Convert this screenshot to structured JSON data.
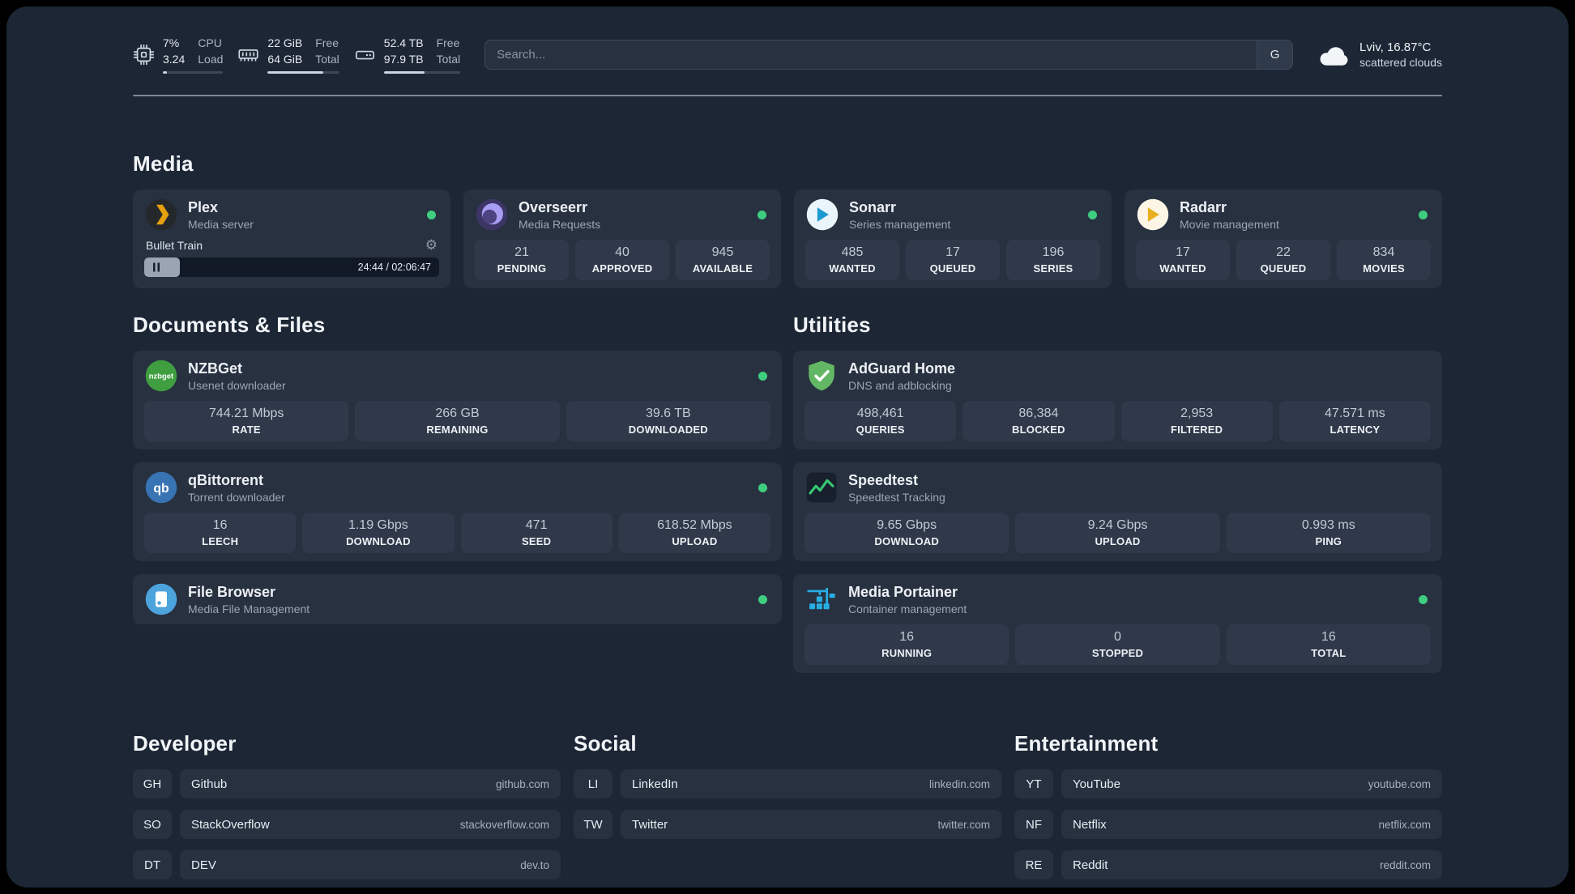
{
  "topbar": {
    "resources": [
      {
        "icon": "cpu-icon",
        "values": [
          "7%",
          "3.24"
        ],
        "labels": [
          "CPU",
          "Load"
        ],
        "percent": 7
      },
      {
        "icon": "memory-icon",
        "values": [
          "22 GiB",
          "64 GiB"
        ],
        "labels": [
          "Free",
          "Total"
        ],
        "percent": 78
      },
      {
        "icon": "disk-icon",
        "values": [
          "52.4 TB",
          "97.9 TB"
        ],
        "labels": [
          "Free",
          "Total"
        ],
        "percent": 53
      }
    ],
    "search": {
      "placeholder": "Search...",
      "button_label": "G"
    },
    "weather": {
      "location": "Lviv, 16.87°C",
      "condition": "scattered clouds"
    }
  },
  "sections": {
    "media": {
      "title": "Media",
      "cards": [
        {
          "name": "Plex",
          "description": "Media server",
          "status": "online",
          "player": {
            "track": "Bullet Train",
            "time": "24:44 / 02:06:47",
            "progress_percent": 12
          }
        },
        {
          "name": "Overseerr",
          "description": "Media Requests",
          "status": "online",
          "stats": [
            {
              "value": "21",
              "label": "PENDING"
            },
            {
              "value": "40",
              "label": "APPROVED"
            },
            {
              "value": "945",
              "label": "AVAILABLE"
            }
          ]
        },
        {
          "name": "Sonarr",
          "description": "Series management",
          "status": "online",
          "stats": [
            {
              "value": "485",
              "label": "WANTED"
            },
            {
              "value": "17",
              "label": "QUEUED"
            },
            {
              "value": "196",
              "label": "SERIES"
            }
          ]
        },
        {
          "name": "Radarr",
          "description": "Movie management",
          "status": "online",
          "stats": [
            {
              "value": "17",
              "label": "WANTED"
            },
            {
              "value": "22",
              "label": "QUEUED"
            },
            {
              "value": "834",
              "label": "MOVIES"
            }
          ]
        }
      ]
    },
    "documents": {
      "title": "Documents & Files",
      "cards": [
        {
          "name": "NZBGet",
          "description": "Usenet downloader",
          "status": "online",
          "stats": [
            {
              "value": "744.21 Mbps",
              "label": "RATE"
            },
            {
              "value": "266 GB",
              "label": "REMAINING"
            },
            {
              "value": "39.6 TB",
              "label": "DOWNLOADED"
            }
          ]
        },
        {
          "name": "qBittorrent",
          "description": "Torrent downloader",
          "status": "online",
          "stats": [
            {
              "value": "16",
              "label": "LEECH"
            },
            {
              "value": "1.19 Gbps",
              "label": "DOWNLOAD"
            },
            {
              "value": "471",
              "label": "SEED"
            },
            {
              "value": "618.52 Mbps",
              "label": "UPLOAD"
            }
          ]
        },
        {
          "name": "File Browser",
          "description": "Media File Management",
          "status": "online"
        }
      ]
    },
    "utilities": {
      "title": "Utilities",
      "cards": [
        {
          "name": "AdGuard Home",
          "description": "DNS and adblocking",
          "stats": [
            {
              "value": "498,461",
              "label": "QUERIES"
            },
            {
              "value": "86,384",
              "label": "BLOCKED"
            },
            {
              "value": "2,953",
              "label": "FILTERED"
            },
            {
              "value": "47.571 ms",
              "label": "LATENCY"
            }
          ]
        },
        {
          "name": "Speedtest",
          "description": "Speedtest Tracking",
          "stats": [
            {
              "value": "9.65 Gbps",
              "label": "DOWNLOAD"
            },
            {
              "value": "9.24 Gbps",
              "label": "UPLOAD"
            },
            {
              "value": "0.993 ms",
              "label": "PING"
            }
          ]
        },
        {
          "name": "Media Portainer",
          "description": "Container management",
          "status": "online",
          "stats": [
            {
              "value": "16",
              "label": "RUNNING"
            },
            {
              "value": "0",
              "label": "STOPPED"
            },
            {
              "value": "16",
              "label": "TOTAL"
            }
          ]
        }
      ]
    },
    "bookmarks": [
      {
        "title": "Developer",
        "items": [
          {
            "abbr": "GH",
            "name": "Github",
            "url": "github.com"
          },
          {
            "abbr": "SO",
            "name": "StackOverflow",
            "url": "stackoverflow.com"
          },
          {
            "abbr": "DT",
            "name": "DEV",
            "url": "dev.to"
          }
        ]
      },
      {
        "title": "Social",
        "items": [
          {
            "abbr": "LI",
            "name": "LinkedIn",
            "url": "linkedin.com"
          },
          {
            "abbr": "TW",
            "name": "Twitter",
            "url": "twitter.com"
          }
        ]
      },
      {
        "title": "Entertainment",
        "items": [
          {
            "abbr": "YT",
            "name": "YouTube",
            "url": "youtube.com"
          },
          {
            "abbr": "NF",
            "name": "Netflix",
            "url": "netflix.com"
          },
          {
            "abbr": "RE",
            "name": "Reddit",
            "url": "reddit.com"
          }
        ]
      }
    ]
  },
  "theme": {
    "green_status": "#3fce7f",
    "panel_bg": "#1c2635",
    "card_bg": "#273140"
  }
}
